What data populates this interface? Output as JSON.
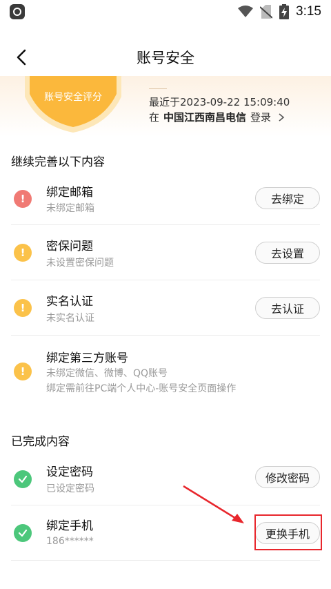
{
  "status_bar": {
    "time": "3:15"
  },
  "header": {
    "title": "账号安全"
  },
  "score": {
    "label": "账号安全评分"
  },
  "last_login": {
    "time_text": "最近于2023-09-22 15:09:40",
    "prefix": "在",
    "location": "中国江西南昌电信",
    "action": "登录"
  },
  "todo_section": {
    "title": "继续完善以下内容",
    "items": [
      {
        "title": "绑定邮箱",
        "subtitle": "未绑定邮箱",
        "button": "去绑定",
        "status": "error"
      },
      {
        "title": "密保问题",
        "subtitle": "未设置密保问题",
        "button": "去设置",
        "status": "warning"
      },
      {
        "title": "实名认证",
        "subtitle": "未实名认证",
        "button": "去认证",
        "status": "warning"
      },
      {
        "title": "绑定第三方账号",
        "subtitle": "未绑定微信、微博、QQ账号",
        "subtitle2": "绑定需前往PC端个人中心-账号安全页面操作",
        "status": "warning"
      }
    ]
  },
  "done_section": {
    "title": "已完成内容",
    "items": [
      {
        "title": "设定密码",
        "subtitle": "已设定密码",
        "button": "修改密码",
        "status": "ok"
      },
      {
        "title": "绑定手机",
        "subtitle": "186******",
        "button": "更换手机",
        "status": "ok"
      }
    ]
  },
  "colors": {
    "error": "#f07a74",
    "warning": "#fbc24a",
    "ok": "#4cc77b",
    "annotation": "#e8262c"
  }
}
